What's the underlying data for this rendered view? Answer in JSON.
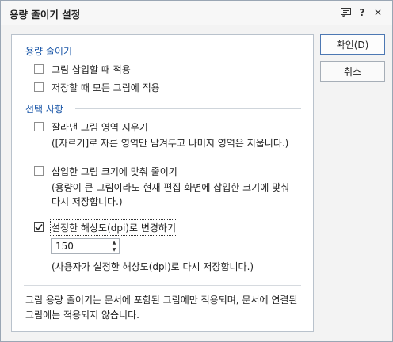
{
  "window": {
    "title": "용량 줄이기 설정",
    "icons": [
      "comment-icon",
      "help-icon",
      "close-icon"
    ],
    "help_glyph": "?",
    "close_glyph": "✕"
  },
  "section_reduce": {
    "title": "용량 줄이기",
    "options": [
      {
        "label": "그림 삽입할 때 적용",
        "checked": false
      },
      {
        "label": "저장할 때 모든 그림에 적용",
        "checked": false
      }
    ]
  },
  "section_options": {
    "title": "선택 사항",
    "crop": {
      "label": "잘라낸 그림 영역 지우기",
      "checked": false,
      "desc": "([자르기]로 자른 영역만 남겨두고 나머지 영역은 지웁니다.)"
    },
    "fit": {
      "label": "삽입한 그림 크기에 맞춰 줄이기",
      "checked": false,
      "desc_line1": "(용량이 큰 그림이라도 현재 편집 화면에 삽입한 크기에 맞춰",
      "desc_line2": "다시 저장합니다.)"
    },
    "dpi": {
      "label": "설정한 해상도(dpi)로 변경하기",
      "checked": true,
      "value": "150",
      "desc": "(사용자가 설정한 해상도(dpi)로 다시 저장합니다.)"
    }
  },
  "note_line1": "그림 용량 줄이기는 문서에 포함된 그림에만 적용되며, 문서에 연결된",
  "note_line2": "그림에는 적용되지 않습니다.",
  "buttons": {
    "ok": "확인(D)",
    "cancel": "취소"
  },
  "colors": {
    "section_title": "#1b57a8",
    "default_button_border": "#4d78b3"
  }
}
